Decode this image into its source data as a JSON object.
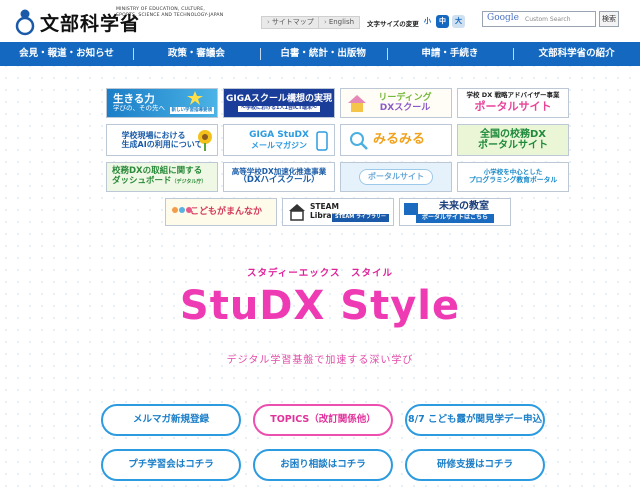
{
  "header": {
    "logo_jp": "文部科学省",
    "logo_en": "MINISTRY OF EDUCATION, CULTURE, SPORTS, SCIENCE AND TECHNOLOGY-JAPAN",
    "sitemap": "サイトマップ",
    "english": "English",
    "font_size_label": "文字サイズの変更",
    "font_small": "小",
    "font_medium": "中",
    "font_large": "大",
    "search_logo": "Google",
    "search_placeholder": "Custom Search",
    "search_button": "検索"
  },
  "nav": [
    "会見・報道・お知らせ",
    "政策・審議会",
    "白書・統計・出版物",
    "申請・手続き",
    "文部科学省の紹介"
  ],
  "banners": {
    "ikiruchikara": {
      "title": "生きる力",
      "sub1": "学びの、その先へ",
      "sub2": "新しい学習指導要領"
    },
    "giga_school": {
      "title": "GIGAスクール構想の実現",
      "sub": "～学校における1人1台ICT端末～"
    },
    "reading_dx": {
      "title": "リーディング",
      "title2": "DXスクール"
    },
    "dx_advisor": {
      "title": "学校 DX 戦略アドバイザー事業",
      "title2": "ポータルサイト"
    },
    "gen_ai": {
      "title": "学校現場における",
      "title2": "生成AIの利用について"
    },
    "giga_studx": {
      "title": "GIGA StuDX",
      "title2": "メールマガジン"
    },
    "mimamiru": {
      "title": "みるみる"
    },
    "koumu_dx": {
      "title": "全国の校務DX",
      "title2": "ポータルサイト"
    },
    "dx_dashboard": {
      "title": "校務DXの取組に関する",
      "title2": "ダッシュボード",
      "note": "（デジタル庁）"
    },
    "dx_high_school": {
      "title": "高等学校DX加速化推進事業",
      "title2": "（DXハイスクール）"
    },
    "portal_site": {
      "title": "ポータルサイト"
    },
    "programming": {
      "title": "小学校を中心とした",
      "title2": "プログラミング教育ポータル"
    },
    "kodomo": {
      "title": "こどもがまんなか"
    },
    "steam_library": {
      "title": "STEAM",
      "title2": "Library",
      "sub": "STEAM ライブラリー"
    },
    "mirai_kyoshitsu": {
      "title": "未来の教室",
      "sub": "ポータルサイトはこちら"
    }
  },
  "hero": {
    "ruby": "スタディーエックス　スタイル",
    "title": "StuDX Style",
    "subtitle": "デジタル学習基盤で加速する深い学び"
  },
  "buttons": [
    "メルマガ新規登録",
    "TOPICS（改訂関係他）",
    "8/7 こども霞が関見学デー申込",
    "プチ学習会はコチラ",
    "お困り相談はコチラ",
    "研修支援はコチラ"
  ],
  "colors": {
    "nav_bg": "#1468bf",
    "hero_pink": "#ee3bb4",
    "pill_blue": "#2c9be0",
    "pill_pink": "#ec4fae"
  }
}
